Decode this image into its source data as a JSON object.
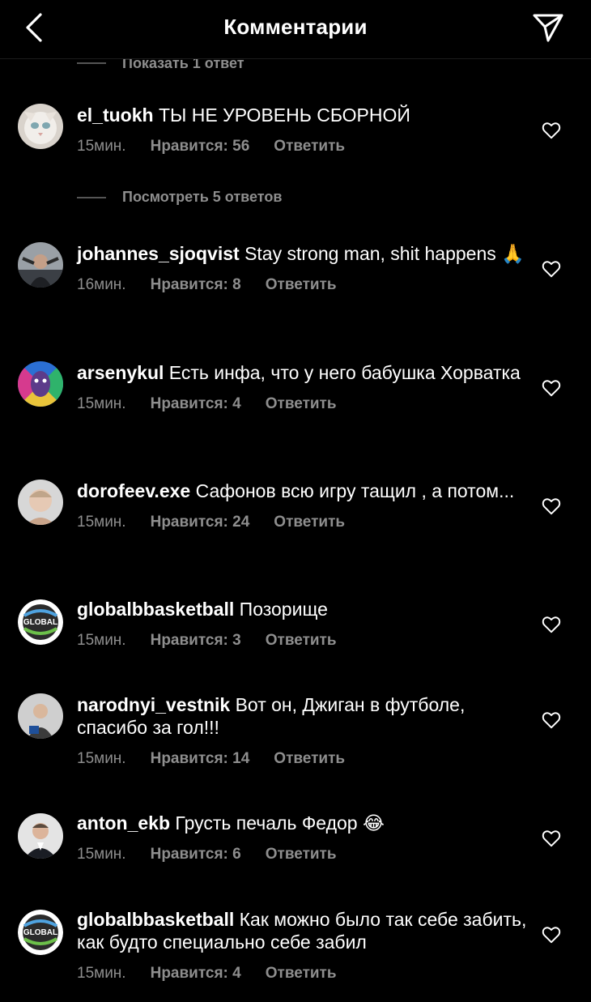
{
  "header": {
    "title": "Комментарии"
  },
  "top_reply": {
    "label": "Показать 1 ответ"
  },
  "view_replies": {
    "label": "Посмотреть 5 ответов"
  },
  "comments": [
    {
      "username": "el_tuokh",
      "text": "ТЫ НЕ УРОВЕНЬ СБОРНОЙ",
      "time": "15мин.",
      "likes": "Нравится: 56",
      "reply": "Ответить"
    },
    {
      "username": "johannes_sjoqvist",
      "text": "Stay strong man, shit happens 🙏",
      "time": "16мин.",
      "likes": "Нравится: 8",
      "reply": "Ответить"
    },
    {
      "username": "arsenykul",
      "text": "Есть инфа, что у него бабушка Хорватка",
      "time": "15мин.",
      "likes": "Нравится: 4",
      "reply": "Ответить"
    },
    {
      "username": "dorofeev.exe",
      "text": "Сафонов всю игру тащил , а потом...",
      "time": "15мин.",
      "likes": "Нравится: 24",
      "reply": "Ответить"
    },
    {
      "username": "globalbbasketball",
      "text": "Позорище",
      "time": "15мин.",
      "likes": "Нравится: 3",
      "reply": "Ответить"
    },
    {
      "username": "narodnyi_vestnik",
      "text": "Вот он, Джиган в футболе, спасибо за гол!!!",
      "time": "15мин.",
      "likes": "Нравится: 14",
      "reply": "Ответить"
    },
    {
      "username": "anton_ekb",
      "text": "Грусть печаль Федор 😂",
      "time": "15мин.",
      "likes": "Нравится: 6",
      "reply": "Ответить"
    },
    {
      "username": "globalbbasketball",
      "text": "Как можно было так себе забить, как будто специально себе забил",
      "time": "15мин.",
      "likes": "Нравится: 4",
      "reply": "Ответить"
    }
  ],
  "avatar_logo_text": "GLOBAL"
}
